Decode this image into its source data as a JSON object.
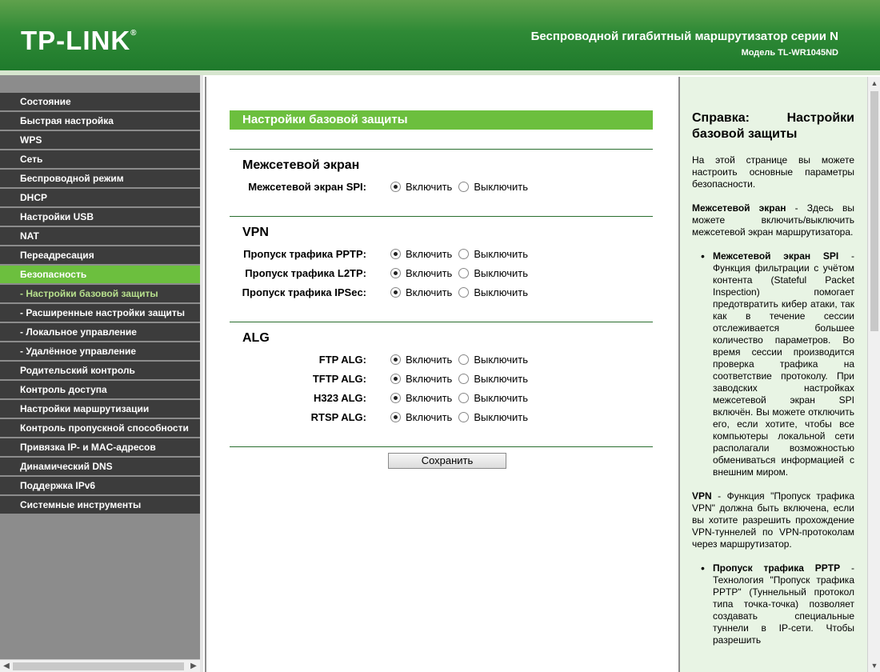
{
  "header": {
    "logo": "TP-LINK",
    "logo_mark": "®",
    "title": "Беспроводной гигабитный маршрутизатор серии N",
    "model": "Модель TL-WR1045ND"
  },
  "menu": {
    "items": [
      {
        "label": "Состояние"
      },
      {
        "label": "Быстрая настройка"
      },
      {
        "label": "WPS"
      },
      {
        "label": "Сеть"
      },
      {
        "label": "Беспроводной режим"
      },
      {
        "label": "DHCP"
      },
      {
        "label": "Настройки USB"
      },
      {
        "label": "NAT"
      },
      {
        "label": "Переадресация"
      },
      {
        "label": "Безопасность"
      },
      {
        "label": "- Настройки базовой защиты"
      },
      {
        "label": "- Расширенные настройки защиты"
      },
      {
        "label": "- Локальное управление"
      },
      {
        "label": "- Удалённое управление"
      },
      {
        "label": "Родительский контроль"
      },
      {
        "label": "Контроль доступа"
      },
      {
        "label": "Настройки маршрутизации"
      },
      {
        "label": "Контроль пропускной способности"
      },
      {
        "label": "Привязка IP- и MAC-адресов"
      },
      {
        "label": "Динамический DNS"
      },
      {
        "label": "Поддержка IPv6"
      },
      {
        "label": "Системные инструменты"
      }
    ]
  },
  "main": {
    "panel_title": "Настройки базовой защиты",
    "enable_label": "Включить",
    "disable_label": "Выключить",
    "firewall": {
      "title": "Межсетевой экран",
      "spi_label": "Межсетевой экран SPI:"
    },
    "vpn": {
      "title": "VPN",
      "pptp_label": "Пропуск трафика PPTP:",
      "l2tp_label": "Пропуск трафика L2TP:",
      "ipsec_label": "Пропуск трафика IPSec:"
    },
    "alg": {
      "title": "ALG",
      "ftp_label": "FTP ALG:",
      "tftp_label": "TFTP ALG:",
      "h323_label": "H323 ALG:",
      "rtsp_label": "RTSP ALG:"
    },
    "save_label": "Сохранить"
  },
  "help": {
    "title": "Справка: Настройки базовой защиты",
    "intro": "На этой странице вы можете настроить основные параметры безопасности.",
    "firewall_term": "Межсетевой экран",
    "firewall_text": " - Здесь вы можете включить/выключить межсетевой экран маршрутизатора.",
    "spi_term": "Межсетевой экран SPI",
    "spi_text": " - Функция фильтрации с учётом контента (Stateful Packet Inspection) помогает предотвратить кибер атаки, так как в течение сессии отслеживается большее количество параметров. Во время сессии производится проверка трафика на соответствие протоколу. При заводских настройках межсетевой экран SPI включён. Вы можете отключить его, если хотите, чтобы все компьютеры локальной сети располагали возможностью обмениваться информацией с внешним миром.",
    "vpn_term": "VPN",
    "vpn_text": " - Функция \"Пропуск трафика VPN\" должна быть включена, если вы хотите разрешить прохождение VPN-туннелей по VPN-протоколам через маршрутизатор.",
    "pptp_term": "Пропуск трафика PPTP",
    "pptp_text": " - Технология \"Пропуск трафика PPTP\" (Туннельный протокол типа точка-точка) позволяет создавать специальные туннели в IP-сети. Чтобы разрешить"
  }
}
